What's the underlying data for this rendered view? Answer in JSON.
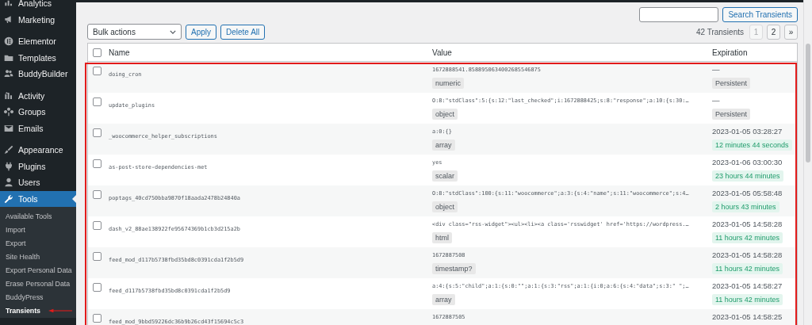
{
  "sidebar": {
    "groups": [
      [
        {
          "label": "Analytics",
          "selected": false
        },
        {
          "label": "Marketing",
          "selected": false
        }
      ],
      [
        {
          "label": "Elementor",
          "selected": false
        },
        {
          "label": "Templates",
          "selected": false
        },
        {
          "label": "BuddyBuilder",
          "selected": false
        }
      ],
      [
        {
          "label": "Activity",
          "selected": false
        },
        {
          "label": "Groups",
          "selected": false
        },
        {
          "label": "Emails",
          "selected": false
        }
      ],
      [
        {
          "label": "Appearance",
          "selected": false
        },
        {
          "label": "Plugins",
          "selected": false
        },
        {
          "label": "Users",
          "selected": false
        },
        {
          "label": "Tools",
          "selected": true
        }
      ]
    ],
    "submenu": [
      {
        "label": "Available Tools",
        "selected": false
      },
      {
        "label": "Import",
        "selected": false
      },
      {
        "label": "Export",
        "selected": false
      },
      {
        "label": "Site Health",
        "selected": false
      },
      {
        "label": "Export Personal Data",
        "selected": false
      },
      {
        "label": "Erase Personal Data",
        "selected": false
      },
      {
        "label": "BuddyPress",
        "selected": false
      },
      {
        "label": "Transients",
        "selected": true
      }
    ]
  },
  "search": {
    "button": "Search Transients"
  },
  "bulk_actions": {
    "value": "Bulk actions",
    "apply": "Apply",
    "delete_all": "Delete All"
  },
  "pagination": {
    "count": "42 Transients",
    "pages": [
      {
        "label": "1",
        "disabled": true
      },
      {
        "label": "2",
        "disabled": false
      },
      {
        "label": "»",
        "disabled": false
      }
    ]
  },
  "table": {
    "select_all": {
      "checked": false
    },
    "columns": [
      "Name",
      "Value",
      "Expiration"
    ],
    "rows": [
      {
        "checked": false,
        "name": "doing_cron",
        "value": "1672888541.8588950634002685546875",
        "type": "numeric",
        "expires": "—",
        "remaining": "Persistent",
        "kind": "persistent"
      },
      {
        "checked": false,
        "name": "update_plugins",
        "value": "O:8:\"stdClass\":5:{s:12:\"last_checked\";i:1672888425;s:8:\"response\";a:10:{s:30:…",
        "type": "object",
        "expires": "—",
        "remaining": "Persistent",
        "kind": "persistent"
      },
      {
        "checked": false,
        "name": "_woocommerce_helper_subscriptions",
        "value": "a:0:{}",
        "type": "array",
        "expires": "2023-01-05 03:28:27",
        "remaining": "12 minutes 44 seconds",
        "kind": "expiring"
      },
      {
        "checked": false,
        "name": "as-post-store-dependencies-met",
        "value": "yes",
        "type": "scalar",
        "expires": "2023-01-06 03:00:30",
        "remaining": "23 hours 44 minutes",
        "kind": "expiring"
      },
      {
        "checked": false,
        "name": "poptags_40cd750bba9870f18aada2478b24840a",
        "value": "O:8:\"stdClass\":100:{s:11:\"woocommerce\";a:3:{s:4:\"name\";s:11:\"woocommerce\";s:4…",
        "type": "object",
        "expires": "2023-01-05 05:58:48",
        "remaining": "2 hours 43 minutes",
        "kind": "expiring"
      },
      {
        "checked": false,
        "name": "dash_v2_88ae138922fe95674369b1cb3d215a2b",
        "value": "<div class=\"rss-widget\"><ul><li><a class='rsswidget' href='https://wordpress.…",
        "type": "html",
        "expires": "2023-01-05 14:58:28",
        "remaining": "11 hours 42 minutes",
        "kind": "expiring"
      },
      {
        "checked": false,
        "name": "feed_mod_d117b5738fbd35bd8c0391cda1f2b5d9",
        "value": "1672887508",
        "type": "timestamp?",
        "expires": "2023-01-05 14:58:28",
        "remaining": "11 hours 42 minutes",
        "kind": "expiring"
      },
      {
        "checked": false,
        "name": "feed_d117b5738fbd35bd8c0391cda1f2b5d9",
        "value": "a:4:{s:5:\"child\";a:1:{s:0:\"\";a:1:{s:3:\"rss\";a:1:{i:0;a:6:{s:4:\"data\";s:3:\" \";…",
        "type": "array",
        "expires": "2023-01-05 14:58:27",
        "remaining": "11 hours 42 minutes",
        "kind": "expiring"
      },
      {
        "checked": false,
        "name": "feed_mod_9bbd59226dc36b9b26cd43f15694c5c3",
        "value": "1672887505",
        "expires": "2023-01-05 14:58:25"
      }
    ]
  }
}
